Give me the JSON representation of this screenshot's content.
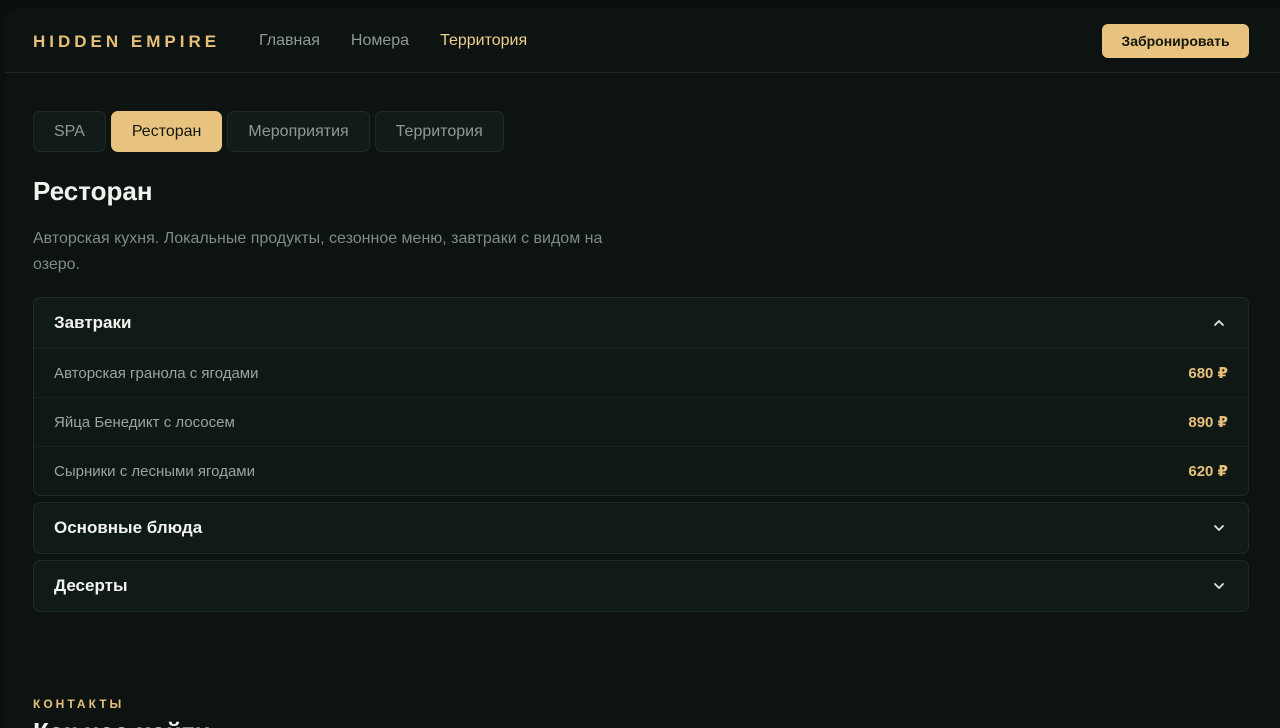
{
  "header": {
    "logo": "HIDDEN EMPIRE",
    "nav": [
      "Главная",
      "Номера",
      "Территория"
    ],
    "active_nav": "Территория",
    "book_button": "Забронировать"
  },
  "tabs": [
    "SPA",
    "Ресторан",
    "Мероприятия",
    "Территория"
  ],
  "active_tab": "Ресторан",
  "section": {
    "title": "Ресторан",
    "description": "Авторская кухня. Локальные продукты, сезонное меню, завтраки с видом на озеро."
  },
  "menu": [
    {
      "title": "Завтраки",
      "expanded": true,
      "items": [
        {
          "name": "Авторская гранола с ягодами",
          "price": "680 ₽"
        },
        {
          "name": "Яйца Бенедикт с лососем",
          "price": "890 ₽"
        },
        {
          "name": "Сырники с лесными ягодами",
          "price": "620 ₽"
        }
      ]
    },
    {
      "title": "Основные блюда",
      "expanded": false
    },
    {
      "title": "Десерты",
      "expanded": false
    }
  ],
  "contacts": {
    "label": "КОНТАКТЫ",
    "title": "Как нас найти"
  },
  "colors": {
    "accent": "#e8c37f",
    "background": "#0c1310"
  },
  "icons": {
    "expanded": "chevron-up-icon",
    "collapsed": "chevron-down-icon"
  }
}
